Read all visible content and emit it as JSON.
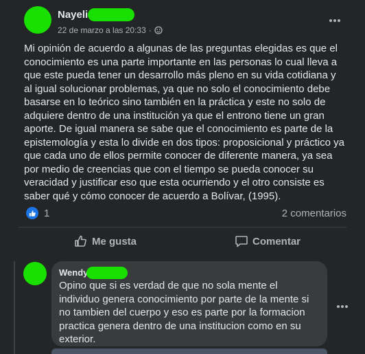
{
  "post": {
    "author": "Nayeli",
    "timestamp": "22 de marzo a las 20:33",
    "audience_icon": "globe-icon",
    "text": "Mi opinión de acuerdo a algunas de las preguntas elegidas es que el conocimiento es una parte importante en las personas lo cual lleva a que este pueda tener un desarrollo más pleno en su vida cotidiana y al igual solucionar problemas, ya que no solo el conocimiento debe basarse en lo teórico sino también en la práctica y este no solo de adquiere dentro de una institución ya que el entrono tiene un gran aporte. De igual manera se sabe que el conocimiento es parte de la epistemología y esta lo divide en dos tipos: proposicional y práctico ya que cada uno de ellos permite conocer de diferente manera, ya sea por medio de creencias que con el tiempo se pueda conocer su veracidad y justificar eso que esta ocurriendo y el otro consiste es saber qué y cómo conocer de acuerdo a Bolívar, (1995).",
    "reactions_count": "1",
    "comments_count": "2 comentarios"
  },
  "actions": {
    "like_label": "Me gusta",
    "comment_label": "Comentar"
  },
  "comment": {
    "author": "Wendy",
    "text": "Opino que si es verdad de que no sola mente el individuo genera conocimiento por parte de la mente si no tambien del cuerpo y eso es parte por la formacion practica genera dentro de una institucion como en su exterior."
  },
  "colors": {
    "background": "#242526",
    "redaction": "#19e000",
    "like_blue": "#1b74e4"
  }
}
